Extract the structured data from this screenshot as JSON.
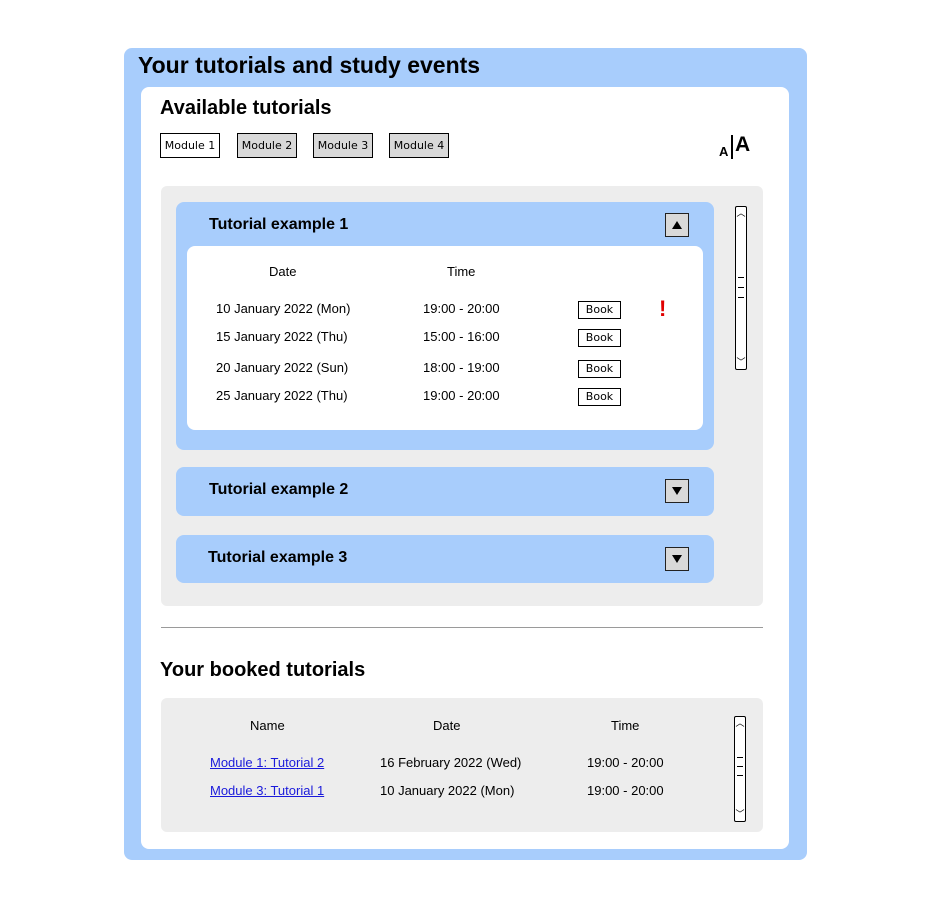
{
  "page_title": "Your tutorials and study events",
  "available": {
    "title": "Available tutorials",
    "module_tabs": [
      "Module 1",
      "Module 2",
      "Module 3",
      "Module 4"
    ],
    "active_tab": "Module 1",
    "font_size_control": {
      "small": "A",
      "large": "A"
    },
    "tutorials": [
      {
        "title": "Tutorial example 1",
        "expanded": true,
        "columns": {
          "date": "Date",
          "time": "Time"
        },
        "sessions": [
          {
            "date": "10 January 2022 (Mon)",
            "time": "19:00 - 20:00",
            "button": "Book",
            "alert": "!"
          },
          {
            "date": "15 January 2022 (Thu)",
            "time": "15:00 - 16:00",
            "button": "Book"
          },
          {
            "date": "20 January 2022 (Sun)",
            "time": "18:00 - 19:00",
            "button": "Book"
          },
          {
            "date": "25 January 2022 (Thu)",
            "time": "19:00 - 20:00",
            "button": "Book"
          }
        ]
      },
      {
        "title": "Tutorial example 2",
        "expanded": false
      },
      {
        "title": "Tutorial example 3",
        "expanded": false
      }
    ]
  },
  "booked": {
    "title": "Your booked tutorials",
    "columns": {
      "name": "Name",
      "date": "Date",
      "time": "Time"
    },
    "rows": [
      {
        "name": "Module 1: Tutorial 2",
        "date": "16 February 2022 (Wed)",
        "time": "19:00 - 20:00"
      },
      {
        "name": "Module 3: Tutorial 1",
        "date": "10 January 2022 (Mon)",
        "time": "19:00 - 20:00"
      }
    ]
  },
  "colors": {
    "accent": "#a8cdfc",
    "panel": "#ededed",
    "alert": "#e00000",
    "link": "#1a1adb"
  }
}
